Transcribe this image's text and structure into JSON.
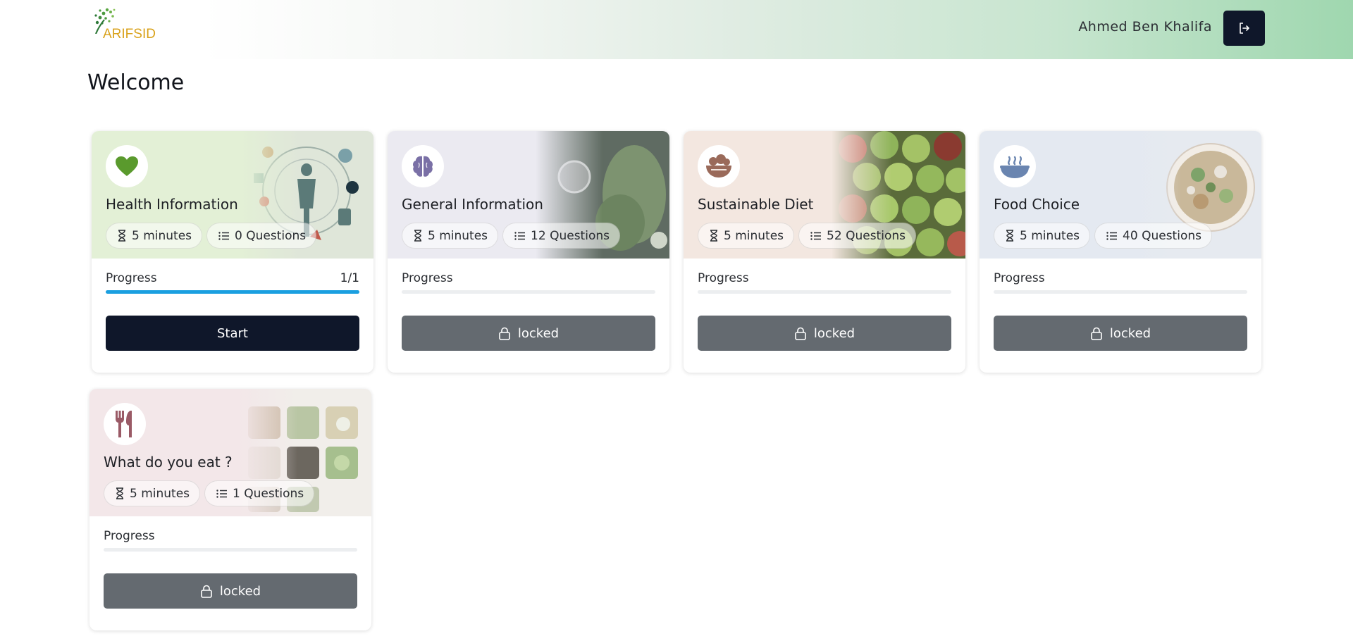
{
  "header": {
    "logo_text": "ARIFSID",
    "user_name": "Ahmed Ben Khalifa",
    "logout_icon": "logout-icon"
  },
  "page": {
    "title": "Welcome"
  },
  "labels": {
    "progress": "Progress"
  },
  "cards": [
    {
      "title": "Health Information",
      "duration": "5 minutes",
      "questions": "0 Questions",
      "progress_text": "1/1",
      "progress": 1.0,
      "button_label": "Start",
      "state": "active",
      "icon": "heart-icon",
      "icon_color": "#5a9a2d",
      "bg": "#e3f0d6"
    },
    {
      "title": "General Information",
      "duration": "5 minutes",
      "questions": "12 Questions",
      "progress_text": "",
      "progress": 0,
      "button_label": "locked",
      "state": "locked",
      "icon": "brain-icon",
      "icon_color": "#7a70a6",
      "bg": "#ebeaf1"
    },
    {
      "title": "Sustainable Diet",
      "duration": "5 minutes",
      "questions": "52 Questions",
      "progress_text": "",
      "progress": 0,
      "button_label": "locked",
      "state": "locked",
      "icon": "salad-bowl-icon",
      "icon_color": "#9a6a5a",
      "bg": "#f3e7e0"
    },
    {
      "title": "Food Choice",
      "duration": "5 minutes",
      "questions": "40 Questions",
      "progress_text": "",
      "progress": 0,
      "button_label": "locked",
      "state": "locked",
      "icon": "hot-bowl-icon",
      "icon_color": "#6a85b0",
      "bg": "#e4e9f1"
    },
    {
      "title": "What do you eat ?",
      "duration": "5 minutes",
      "questions": "1 Questions",
      "progress_text": "",
      "progress": 0,
      "button_label": "locked",
      "state": "locked",
      "icon": "utensils-icon",
      "icon_color": "#9a5a66",
      "bg": "#f3e7e9"
    }
  ]
}
